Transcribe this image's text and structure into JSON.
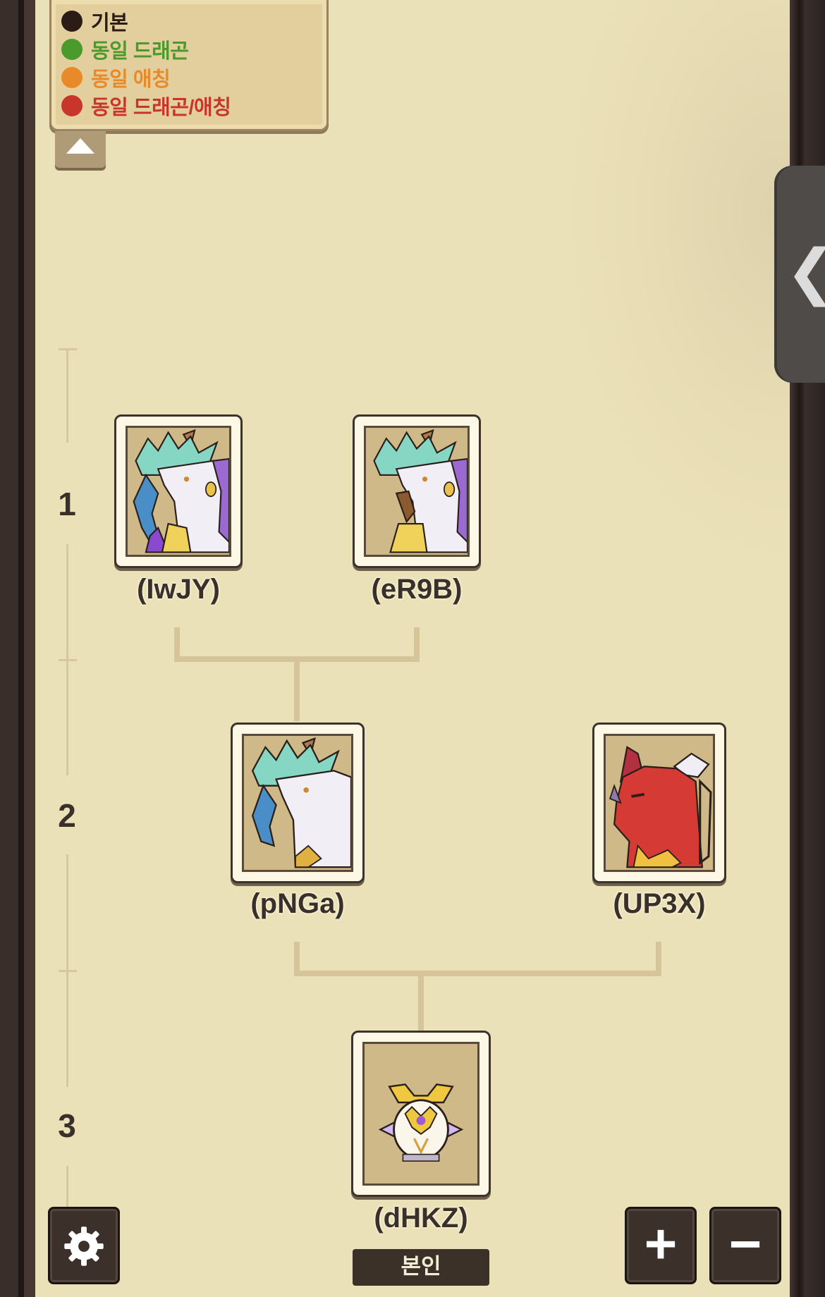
{
  "legend": {
    "items": [
      {
        "label": "기본",
        "color": "#2b1d15"
      },
      {
        "label": "동일 드래곤",
        "color": "#4a9a2c"
      },
      {
        "label": "동일 애칭",
        "color": "#e88a2a"
      },
      {
        "label": "동일 드래곤/애칭",
        "color": "#c8352a"
      }
    ]
  },
  "generations": [
    "1",
    "2",
    "3"
  ],
  "tree": {
    "gen1": [
      {
        "name": "(IwJY)",
        "portrait": "ice-dragon-portrait"
      },
      {
        "name": "(eR9B)",
        "portrait": "ice-dragon-portrait"
      }
    ],
    "gen2": [
      {
        "name": "(pNGa)",
        "portrait": "ice-dragon-portrait"
      },
      {
        "name": "(UP3X)",
        "portrait": "red-dragon-portrait"
      }
    ],
    "gen3": [
      {
        "name": "(dHKZ)",
        "portrait": "golden-egg-portrait",
        "badge": "본인"
      }
    ]
  },
  "controls": {
    "settings_icon": "gear-icon",
    "zoom_in_symbol": "+",
    "zoom_out_symbol": "−",
    "drawer_symbol": "❮"
  }
}
